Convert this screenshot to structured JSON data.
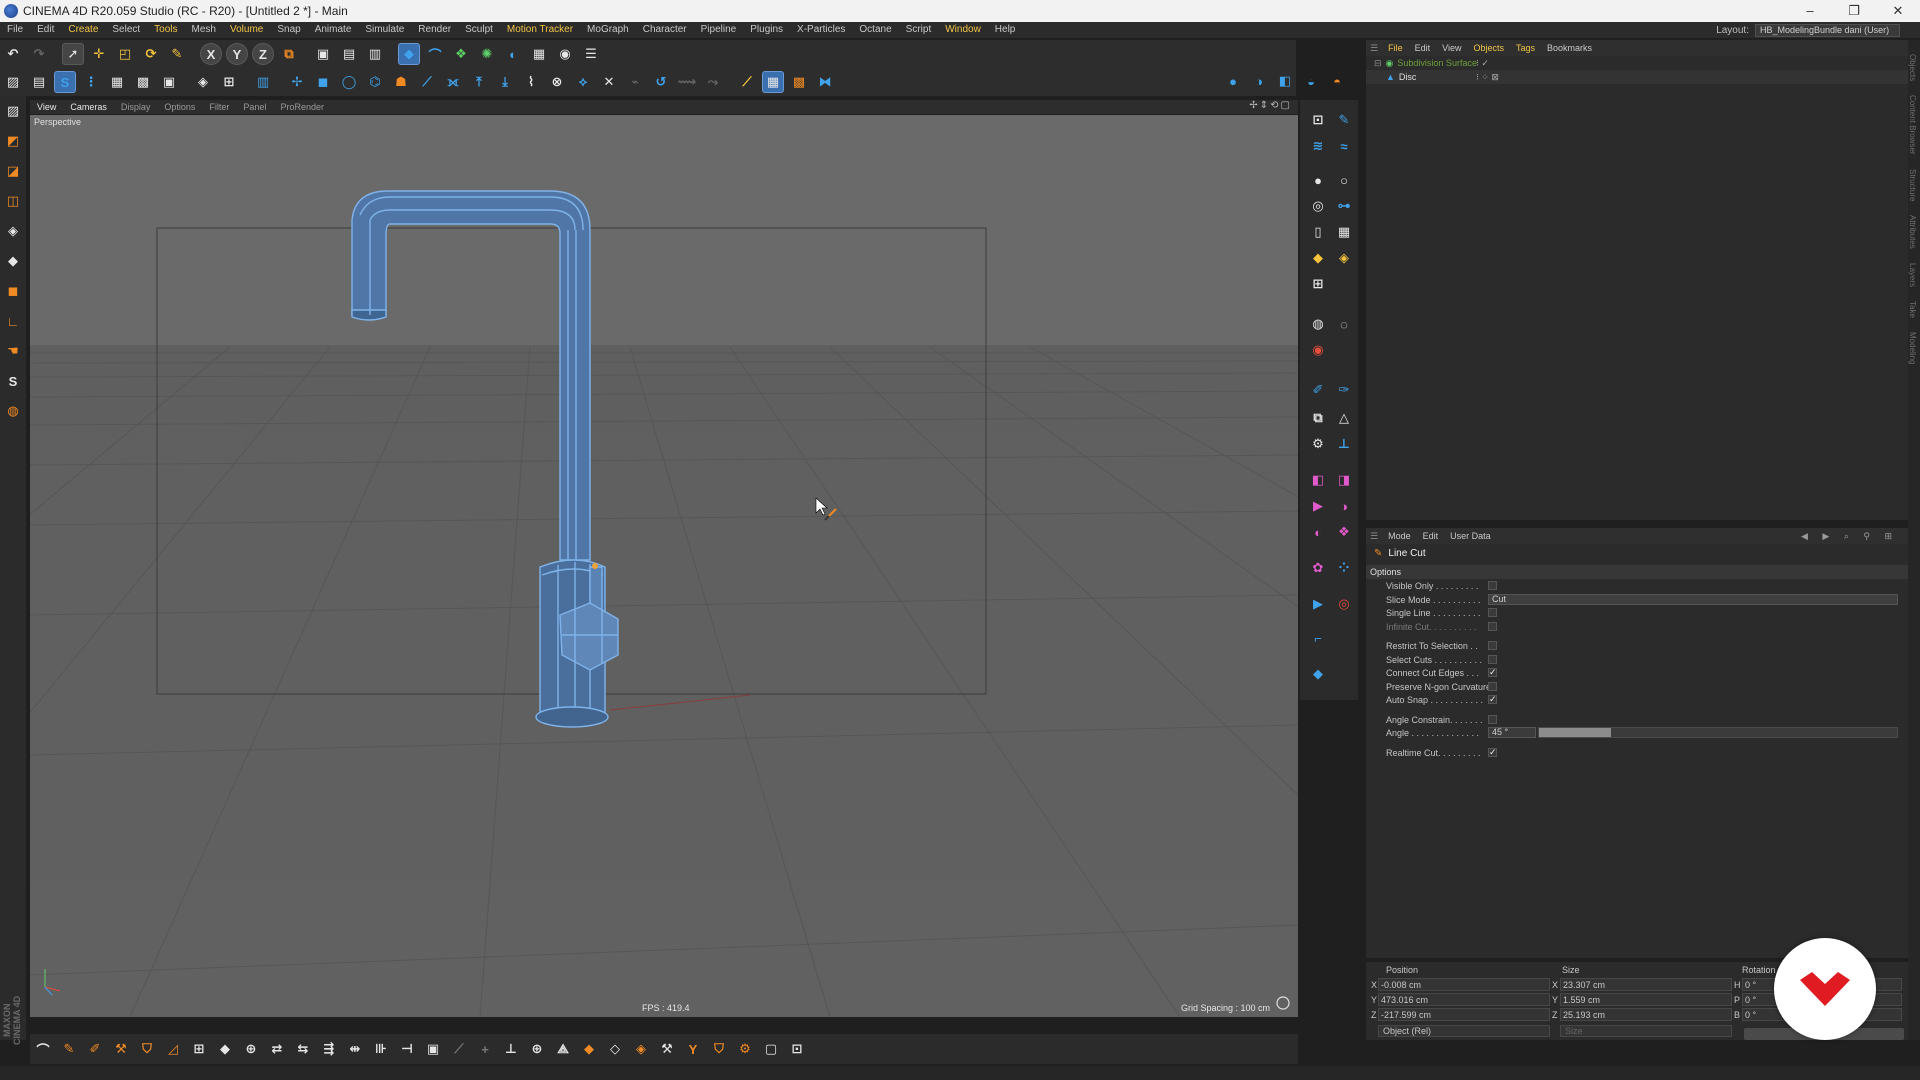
{
  "window": {
    "title": "CINEMA 4D R20.059 Studio (RC - R20) - [Untitled 2 *] - Main",
    "min": "–",
    "max": "❐",
    "close": "✕"
  },
  "menu": {
    "items": [
      "File",
      "Edit",
      "Create",
      "Select",
      "Tools",
      "Mesh",
      "Volume",
      "Snap",
      "Animate",
      "Simulate",
      "Render",
      "Sculpt",
      "Motion Tracker",
      "MoGraph",
      "Character",
      "Pipeline",
      "Plugins",
      "X-Particles",
      "Octane",
      "Script",
      "Window",
      "Help"
    ],
    "layout_label": "Layout:",
    "layout_value": "HB_ModelingBundle dani (User)"
  },
  "viewport": {
    "menu": [
      "View",
      "Cameras",
      "Display",
      "Options",
      "Filter",
      "Panel",
      "ProRender"
    ],
    "camera_label": "Perspective",
    "fps": "FPS : 419.4",
    "grid_spacing": "Grid Spacing : 100 cm",
    "colors": {
      "mesh": "#4f76a6",
      "wire": "#78aee8",
      "grid": "#555555"
    }
  },
  "objects_panel": {
    "menu": [
      "File",
      "Edit",
      "View",
      "Objects",
      "Tags",
      "Bookmarks"
    ],
    "objects": [
      {
        "name": "Subdivision Surface",
        "color": "#6f9f3a"
      },
      {
        "name": "Disc",
        "color": "#e0e0e0"
      }
    ]
  },
  "attributes_panel": {
    "menu": [
      "Mode",
      "Edit",
      "User Data"
    ],
    "tool_name": "Line Cut",
    "section": "Options",
    "fields": [
      {
        "label": "Visible Only . . . . . . . . .",
        "type": "check",
        "checked": ""
      },
      {
        "label": "Slice Mode . . . . . . . . . .",
        "type": "dropdown",
        "value": "Cut"
      },
      {
        "label": "Single Line . . . . . . . . . .",
        "type": "check",
        "checked": ""
      },
      {
        "label": "Infinite Cut. . . . . . . . . .",
        "type": "check",
        "checked": "",
        "dim": true
      },
      {
        "label": "",
        "type": "gap"
      },
      {
        "label": "Restrict To Selection . .",
        "type": "check",
        "checked": ""
      },
      {
        "label": "Select Cuts . . . . . . . . . .",
        "type": "check",
        "checked": ""
      },
      {
        "label": "Connect Cut Edges . . .",
        "type": "check",
        "checked": "✓"
      },
      {
        "label": "Preserve N-gon Curvature",
        "type": "check",
        "checked": ""
      },
      {
        "label": "Auto Snap . . . . . . . . . . .",
        "type": "check",
        "checked": "✓"
      },
      {
        "label": "",
        "type": "gap"
      },
      {
        "label": "Angle Constrain. . . . . . .",
        "type": "check",
        "checked": ""
      },
      {
        "label": "Angle . . . . . . . . . . . . . .",
        "type": "slider",
        "value": "45 °",
        "fill": 0.2
      },
      {
        "label": "",
        "type": "gap"
      },
      {
        "label": "Realtime Cut. . . . . . . . .",
        "type": "check",
        "checked": "✓"
      }
    ]
  },
  "coords": {
    "headers": [
      "Position",
      "Size",
      "Rotation"
    ],
    "rows": [
      {
        "axis": "X",
        "pos": "-0.008 cm",
        "size_axis": "X",
        "size": "23.307 cm",
        "rot_axis": "H",
        "rot": "0 °"
      },
      {
        "axis": "Y",
        "pos": "473.016 cm",
        "size_axis": "Y",
        "size": "1.559 cm",
        "rot_axis": "P",
        "rot": "0 °"
      },
      {
        "axis": "Z",
        "pos": "-217.599 cm",
        "size_axis": "Z",
        "size": "25.193 cm",
        "rot_axis": "B",
        "rot": "0 °"
      }
    ],
    "mode": "Object (Rel)",
    "size_mode": "Size",
    "apply": ""
  },
  "brand_vertical": "MAXON CINEMA 4D",
  "side_tabs": [
    "Objects",
    "Content Browser",
    "Structure",
    "Attributes",
    "Layers",
    "Take",
    "Modeling"
  ],
  "badge": {
    "color": "#e01b22"
  }
}
